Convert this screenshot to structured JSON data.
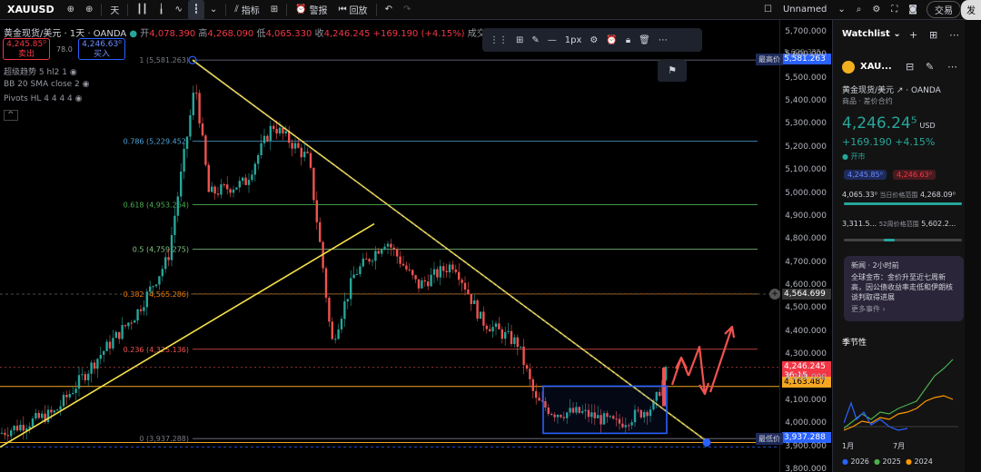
{
  "toolbar": {
    "symbol": "XAUUSD",
    "interval": "天",
    "indicators_label": "指标",
    "alert_label": "警报",
    "replay_label": "回放",
    "layout_name": "Unnamed",
    "trade_label": "交易",
    "publish_label": "发"
  },
  "legend": {
    "title": "黄金现货/美元 · 1天 · OANDA",
    "open_label": "开",
    "open": "4,078.390",
    "high_label": "高",
    "high": "4,268.090",
    "low_label": "低",
    "low": "4,065.330",
    "close_label": "收",
    "close": "4,246.245",
    "change": "+169.190 (+4.15%)",
    "volume_label": "成交"
  },
  "trade_boxes": {
    "sell_price": "4,245.85⁰",
    "sell_label": "卖出",
    "spread": "78.0",
    "buy_price": "4,246.63⁰",
    "buy_label": "买入"
  },
  "indicators": [
    {
      "label": "超级趋势 5 hl2 1"
    },
    {
      "label": "BB 20 SMA close 2"
    },
    {
      "label": "Pivots HL 4 4 4 4"
    }
  ],
  "drawing_toolbar": {
    "width_label": "1px"
  },
  "fib_levels": [
    {
      "label": "1 (5,581.263)",
      "price": 5581.263,
      "color": "#787b86"
    },
    {
      "label": "0.786 (5,229.452)",
      "price": 5229.452,
      "color": "#4fa3d9"
    },
    {
      "label": "0.618 (4,953.264)",
      "price": 4953.264,
      "color": "#4caf50"
    },
    {
      "label": "0.5 (4,759.275)",
      "price": 4759.275,
      "color": "#81c784"
    },
    {
      "label": "0.382 (4,565.286)",
      "price": 4565.286,
      "color": "#f57c00"
    },
    {
      "label": "0.236 (4,325.136)",
      "price": 4325.136,
      "color": "#ef5350"
    },
    {
      "label": "0 (3,937.288)",
      "price": 3937.288,
      "color": "#787b86"
    }
  ],
  "price_axis": {
    "ticks": [
      "5,700.000",
      "5,600.000",
      "5,500.000",
      "5,400.000",
      "5,300.000",
      "5,200.000",
      "5,100.000",
      "5,000.000",
      "4,900.000",
      "4,800.000",
      "4,700.000",
      "4,600.000",
      "4,500.000",
      "4,400.000",
      "4,300.000",
      "4,200.000",
      "4,100.000",
      "4,000.000",
      "3,900.000",
      "3,800.000"
    ],
    "high_label": "最高价",
    "high_value": "5,581.263",
    "low_label": "最低价",
    "low_value": "3,937.288",
    "crosshair_value": "4,564.699",
    "last_price": "4,246.245",
    "countdown": "36:15",
    "level_value": "4,163.487",
    "faint_top": "5,620.335"
  },
  "chart_data": {
    "type": "candlestick",
    "ylim": [
      3800,
      5700
    ],
    "annotations": [
      "falling resistance trendline from 5,581 high",
      "rising support trendline",
      "consolidation box 3,960–4,160",
      "arrows projecting upside to ~4,500"
    ],
    "last_close": 4246.245,
    "high": 5581.263,
    "low": 3937.288
  },
  "watchlist": {
    "header": "Watchlist",
    "symbol": "XAU...",
    "name": "黄金现货/美元",
    "broker": "OANDA",
    "category": "商品 · 差价合约",
    "price": "4,246.24⁵",
    "currency": "USD",
    "change": "+169.190",
    "change_pct": "+4.15%",
    "status": "开市",
    "bid": "4,245.85⁰",
    "ask": "4,246.63⁰",
    "day_low": "4,065.33⁰",
    "day_range_label": "当日价格范围",
    "day_high": "4,268.09⁰",
    "wk_low": "3,311.5...",
    "wk_range_label": "52周价格范围",
    "wk_high": "5,602.2...",
    "news_tag": "新闻 · 2小时前",
    "news_body": "全球金市：金价升至近七周新高，因公债收益率走低和伊朗核谈判取得进展",
    "news_more": "更多事件 ›",
    "seasonal_title": "季节性",
    "seasonal_xlabels": [
      "1月",
      "7月"
    ],
    "seasonal_legend": [
      {
        "name": "2026",
        "color": "#2962ff"
      },
      {
        "name": "2025",
        "color": "#4caf50"
      },
      {
        "name": "2024",
        "color": "#ff9800"
      }
    ]
  },
  "colors": {
    "up": "#26a69a",
    "down": "#ef5350",
    "trendline": "#f5e04a",
    "box": "#2962ff",
    "arrow": "#ef5350"
  }
}
